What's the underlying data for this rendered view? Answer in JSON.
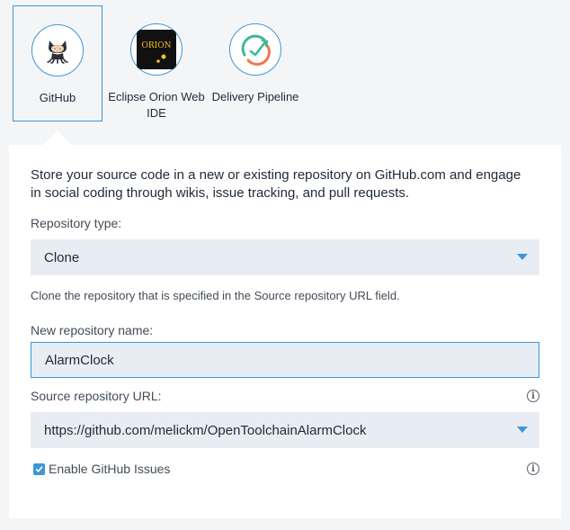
{
  "tools": [
    {
      "label": "GitHub",
      "icon": "github-octocat-icon",
      "selected": true
    },
    {
      "label": "Eclipse Orion Web IDE",
      "icon": "orion-icon",
      "logo_text": "ORION",
      "selected": false
    },
    {
      "label": "Delivery Pipeline",
      "icon": "delivery-pipeline-icon",
      "selected": false
    }
  ],
  "panel": {
    "description": "Store your source code in a new or existing repository on GitHub.com and engage in social coding through wikis, issue tracking, and pull requests.",
    "repository_type": {
      "label": "Repository type:",
      "value": "Clone",
      "help": "Clone the repository that is specified in the Source repository URL field."
    },
    "new_repository_name": {
      "label": "New repository name:",
      "value": "AlarmClock"
    },
    "source_repository_url": {
      "label": "Source repository URL:",
      "value": "https://github.com/melickm/OpenToolchainAlarmClock"
    },
    "enable_issues": {
      "label": "Enable GitHub Issues",
      "checked": true
    }
  },
  "colors": {
    "accent": "#3d96d8",
    "field_bg": "#e8edf3",
    "page_bg": "#f4f5f7",
    "orion_bg": "#111111",
    "orion_text": "#f5c518",
    "pipeline_green": "#3cb89a",
    "pipeline_orange": "#f0784a"
  }
}
